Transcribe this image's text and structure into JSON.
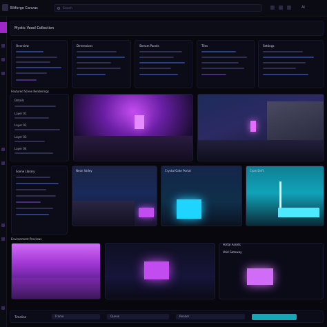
{
  "app": {
    "title": "Bitforge Canvas",
    "search_placeholder": "Search",
    "user_label": "Al"
  },
  "header": {
    "title": "Mystic Voxel Collection"
  },
  "top_cards": [
    {
      "title": "Overview"
    },
    {
      "title": "Dimensions"
    },
    {
      "title": "Stream Panels"
    },
    {
      "title": "Tiles"
    },
    {
      "title": "Settings"
    }
  ],
  "row2": {
    "label": "Featured Scene Renderings",
    "panel_title": "Details",
    "panel_items": [
      "Layer 01",
      "Layer 02",
      "Layer 03",
      "Layer 04"
    ]
  },
  "row3": {
    "label": "Scene Library",
    "thumbs": [
      {
        "caption": "Neon Valley"
      },
      {
        "caption": "Crystal Gate Portal"
      },
      {
        "caption": "Cyan Drift"
      }
    ]
  },
  "row4": {
    "label": "Environment Previews",
    "right_label": "Portal Assets",
    "right_caption": "Void Gateway"
  },
  "bottom": {
    "label": "Timeline",
    "segments": [
      "Frame",
      "Queue",
      "Render"
    ]
  },
  "colors": {
    "accent": "#a126c9",
    "cyan": "#13a7b8",
    "bg": "#07070d"
  }
}
